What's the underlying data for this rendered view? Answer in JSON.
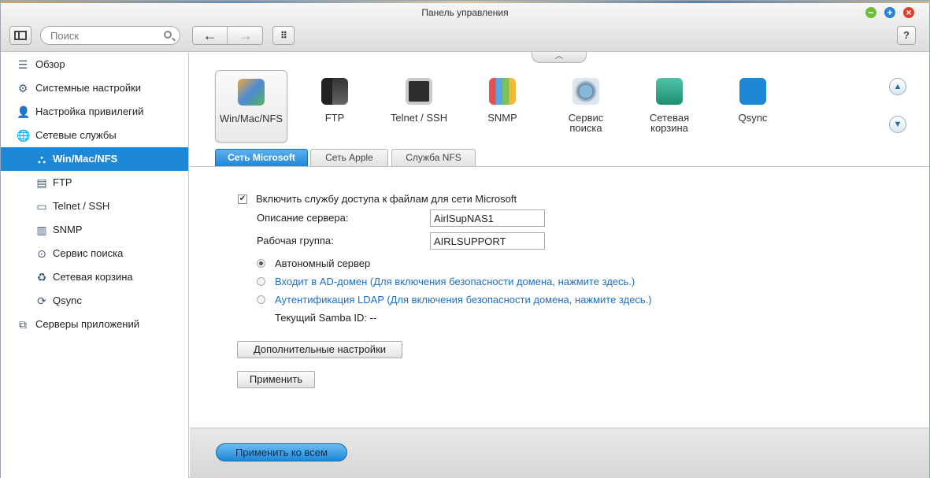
{
  "window": {
    "title": "Панель управления"
  },
  "toolbar": {
    "search_placeholder": "Поиск",
    "back_glyph": "←",
    "forward_glyph": "→",
    "apps_glyph": "⠿",
    "help_label": "?"
  },
  "sidebar": {
    "items": [
      {
        "label": "Обзор",
        "icon": "overview-icon",
        "glyph": "☰"
      },
      {
        "label": "Системные настройки",
        "icon": "gear-icon",
        "glyph": "⚙"
      },
      {
        "label": "Настройка привилегий",
        "icon": "user-icon",
        "glyph": "👤"
      },
      {
        "label": "Сетевые службы",
        "icon": "globe-icon",
        "glyph": "🌐"
      },
      {
        "label": "Win/Mac/NFS",
        "icon": "network-share-icon",
        "glyph": "⛬",
        "active": true
      },
      {
        "label": "FTP",
        "icon": "ftp-icon",
        "glyph": "▤"
      },
      {
        "label": "Telnet / SSH",
        "icon": "terminal-icon",
        "glyph": "▭"
      },
      {
        "label": "SNMP",
        "icon": "bar-chart-icon",
        "glyph": "▥"
      },
      {
        "label": "Сервис поиска",
        "icon": "discovery-icon",
        "glyph": "⊙"
      },
      {
        "label": "Сетевая корзина",
        "icon": "recycle-bin-icon",
        "glyph": "♻"
      },
      {
        "label": "Qsync",
        "icon": "sync-icon",
        "glyph": "⟳"
      },
      {
        "label": "Серверы приложений",
        "icon": "app-server-icon",
        "glyph": "⧉"
      }
    ]
  },
  "apps": [
    {
      "label": "Win/Mac/NFS",
      "icon": "win-mac-nfs-icon",
      "selected": true
    },
    {
      "label": "FTP",
      "icon": "ftp-icon"
    },
    {
      "label": "Telnet / SSH",
      "icon": "terminal-icon"
    },
    {
      "label": "SNMP",
      "icon": "bar-chart-icon"
    },
    {
      "label": "Сервис\nпоиска",
      "icon": "discovery-icon"
    },
    {
      "label": "Сетевая\nкорзина",
      "icon": "recycle-bin-icon"
    },
    {
      "label": "Qsync",
      "icon": "sync-icon"
    }
  ],
  "tabs": [
    {
      "label": "Сеть Microsoft",
      "active": true
    },
    {
      "label": "Сеть Apple"
    },
    {
      "label": "Служба NFS"
    }
  ],
  "form": {
    "enable_label": "Включить службу доступа к файлам для сети Microsoft",
    "enable_checked": true,
    "enable_glyph": "✔",
    "server_desc_label": "Описание сервера:",
    "server_desc_value": "AirlSupNAS1",
    "workgroup_label": "Рабочая группа:",
    "workgroup_value": "AIRLSUPPORT",
    "radio_standalone": "Автономный сервер",
    "radio_ad": "Входит в AD-домен (Для включения безопасности домена, нажмите здесь.)",
    "radio_ldap": "Аутентификация LDAP (Для включения безопасности домена, нажмите здесь.)",
    "samba_id": "Текущий Samba ID: --",
    "advanced_button": "Дополнительные настройки",
    "apply_button": "Применить"
  },
  "footer": {
    "apply_all_button": "Применить ко всем"
  },
  "collapse_glyph": "︿",
  "scroll_up_glyph": "▲",
  "scroll_down_glyph": "▼",
  "win_min_glyph": "−",
  "win_max_glyph": "+",
  "win_close_glyph": "×"
}
